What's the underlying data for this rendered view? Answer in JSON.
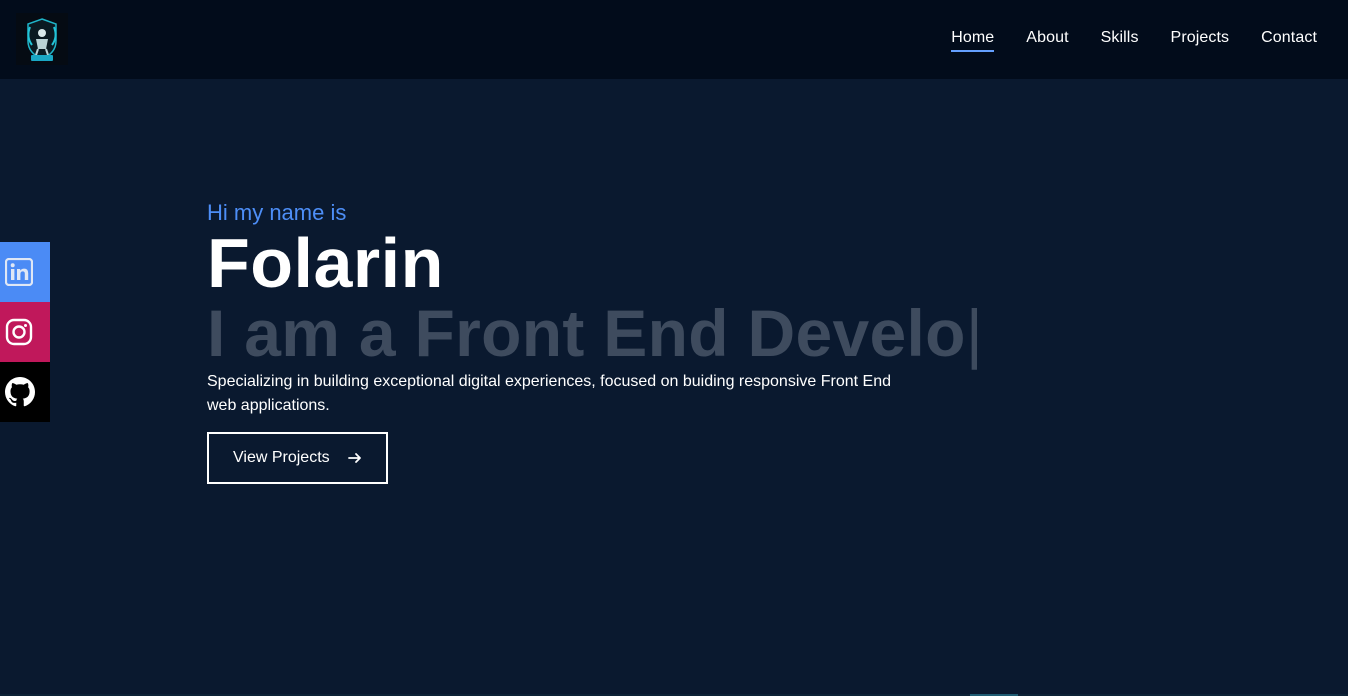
{
  "nav": {
    "logo_alt": "logo",
    "links": [
      {
        "label": "Home",
        "active": true
      },
      {
        "label": "About",
        "active": false
      },
      {
        "label": "Skills",
        "active": false
      },
      {
        "label": "Projects",
        "active": false
      },
      {
        "label": "Contact",
        "active": false
      }
    ]
  },
  "social": [
    {
      "name": "linkedin",
      "icon": "linkedin-icon",
      "color": "#4b8bf5"
    },
    {
      "name": "instagram",
      "icon": "instagram-icon",
      "color": "#c0185b"
    },
    {
      "name": "github",
      "icon": "github-icon",
      "color": "#000000"
    }
  ],
  "hero": {
    "greeting": "Hi my name is",
    "name": "Folarin",
    "typed_text": "I am a Front End Develo",
    "cursor": "|",
    "description": "Specializing in building exceptional digital experiences, focused on buiding responsive Front End web applications.",
    "cta_label": "View Projects",
    "cta_icon": "arrow-right-icon"
  },
  "colors": {
    "background": "#0a192f",
    "navbar": "#020c1b",
    "accent": "#4d8ef7",
    "typed": "#3e4b5e"
  }
}
